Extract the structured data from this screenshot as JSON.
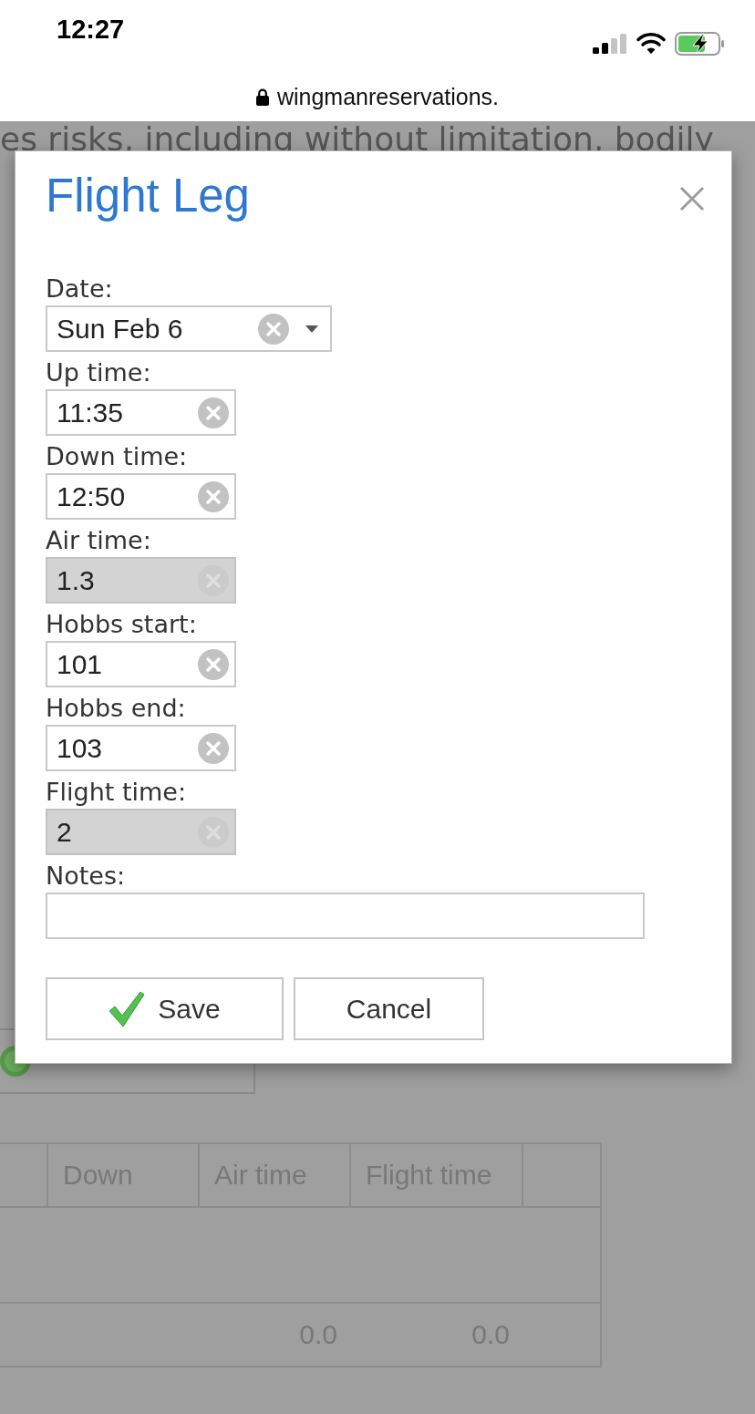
{
  "status_bar": {
    "time": "12:27"
  },
  "browser": {
    "url": "wingmanreservations."
  },
  "page": {
    "text": "es risks, including without limitation, bodily",
    "table": {
      "columns": [
        {
          "label": "Down"
        },
        {
          "label": "Air time"
        },
        {
          "label": "Flight time"
        }
      ],
      "rows": [
        {
          "kind": "empty"
        },
        {
          "kind": "total",
          "cells": [
            null,
            "0.0",
            "0.0"
          ]
        }
      ]
    }
  },
  "dialog": {
    "title": "Flight Leg",
    "fields": [
      {
        "label": "Date:",
        "value": "Sun Feb 6",
        "kind": "dropdown",
        "disabled": false
      },
      {
        "label": "Up time:",
        "value": "11:35",
        "kind": "text",
        "disabled": false
      },
      {
        "label": "Down time:",
        "value": "12:50",
        "kind": "text",
        "disabled": false
      },
      {
        "label": "Air time:",
        "value": "1.3",
        "kind": "text",
        "disabled": true
      },
      {
        "label": "Hobbs start:",
        "value": "101",
        "kind": "text",
        "disabled": false
      },
      {
        "label": "Hobbs end:",
        "value": "103",
        "kind": "text",
        "disabled": false
      },
      {
        "label": "Flight time:",
        "value": "2",
        "kind": "text",
        "disabled": true
      },
      {
        "label": "Notes:",
        "kind": "memo",
        "disabled": false
      }
    ],
    "buttons": [
      {
        "label": "Save",
        "kind": "save"
      },
      {
        "label": "Cancel",
        "kind": "cancel"
      }
    ]
  }
}
